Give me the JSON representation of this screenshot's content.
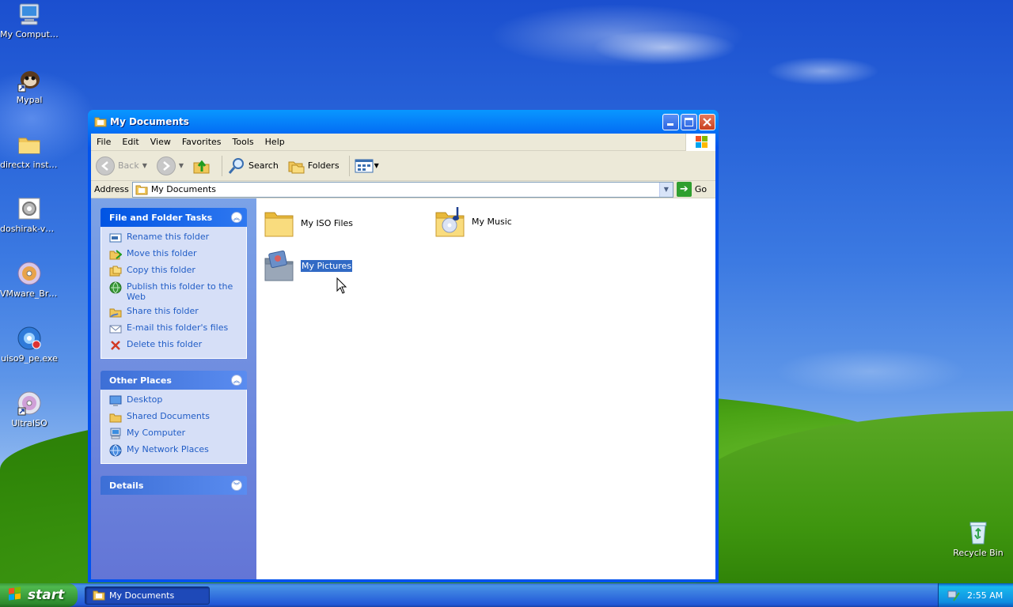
{
  "desktop": {
    "icons": [
      {
        "label": "My Computer",
        "icon": "my-computer-icon"
      },
      {
        "label": "Mypal",
        "icon": "mypal-icon"
      },
      {
        "label": "directx instaler",
        "icon": "folder-icon"
      },
      {
        "label": "doshirak-ve...",
        "icon": "gear-file-icon"
      },
      {
        "label": "VMware_Bri...",
        "icon": "disc-icon"
      },
      {
        "label": "uiso9_pe.exe",
        "icon": "iso-disc-icon"
      },
      {
        "label": "UltraISO",
        "icon": "ultraiso-icon"
      }
    ],
    "recycle_bin": "Recycle Bin"
  },
  "window": {
    "title": "My Documents",
    "menu": [
      "File",
      "Edit",
      "View",
      "Favorites",
      "Tools",
      "Help"
    ],
    "toolbar": {
      "back": "Back",
      "search": "Search",
      "folders": "Folders"
    },
    "address": {
      "label": "Address",
      "value": "My Documents",
      "go": "Go"
    },
    "tasks": {
      "file_folder": {
        "title": "File and Folder Tasks",
        "items": [
          "Rename this folder",
          "Move this folder",
          "Copy this folder",
          "Publish this folder to the Web",
          "Share this folder",
          "E-mail this folder's files",
          "Delete this folder"
        ]
      },
      "other_places": {
        "title": "Other Places",
        "items": [
          "Desktop",
          "Shared Documents",
          "My Computer",
          "My Network Places"
        ]
      },
      "details": {
        "title": "Details"
      }
    },
    "files": [
      {
        "name": "My ISO Files",
        "icon": "folder-icon"
      },
      {
        "name": "My Music",
        "icon": "music-folder-icon"
      },
      {
        "name": "My Pictures",
        "icon": "pictures-folder-icon",
        "selected": true
      }
    ]
  },
  "taskbar": {
    "start": "start",
    "task_button": "My Documents",
    "clock": "2:55 AM"
  }
}
